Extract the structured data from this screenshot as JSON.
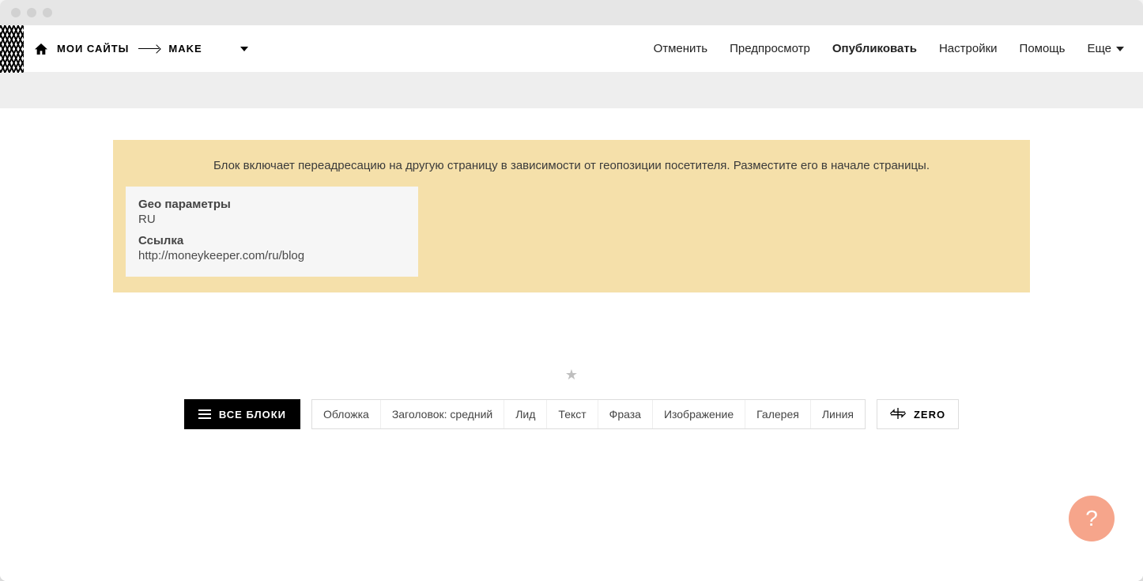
{
  "breadcrumbs": {
    "home_label": "МОИ САЙТЫ",
    "current": "MAKE"
  },
  "nav": {
    "cancel": "Отменить",
    "preview": "Предпросмотр",
    "publish": "Опубликовать",
    "settings": "Настройки",
    "help": "Помощь",
    "more": "Еще"
  },
  "geo_block": {
    "notice": "Блок включает переадресацию на другую страницу в зависимости от геопозиции посетителя. Разместите его в начале страницы.",
    "params_title": "Geo параметры",
    "params_value": "RU",
    "link_title": "Ссылка",
    "link_value": "http://moneykeeper.com/ru/blog"
  },
  "picker": {
    "all_blocks": "ВСЕ БЛОКИ",
    "cats": [
      "Обложка",
      "Заголовок: средний",
      "Лид",
      "Текст",
      "Фраза",
      "Изображение",
      "Галерея",
      "Линия"
    ],
    "zero": "ZERO"
  },
  "fab": {
    "help_symbol": "?"
  }
}
